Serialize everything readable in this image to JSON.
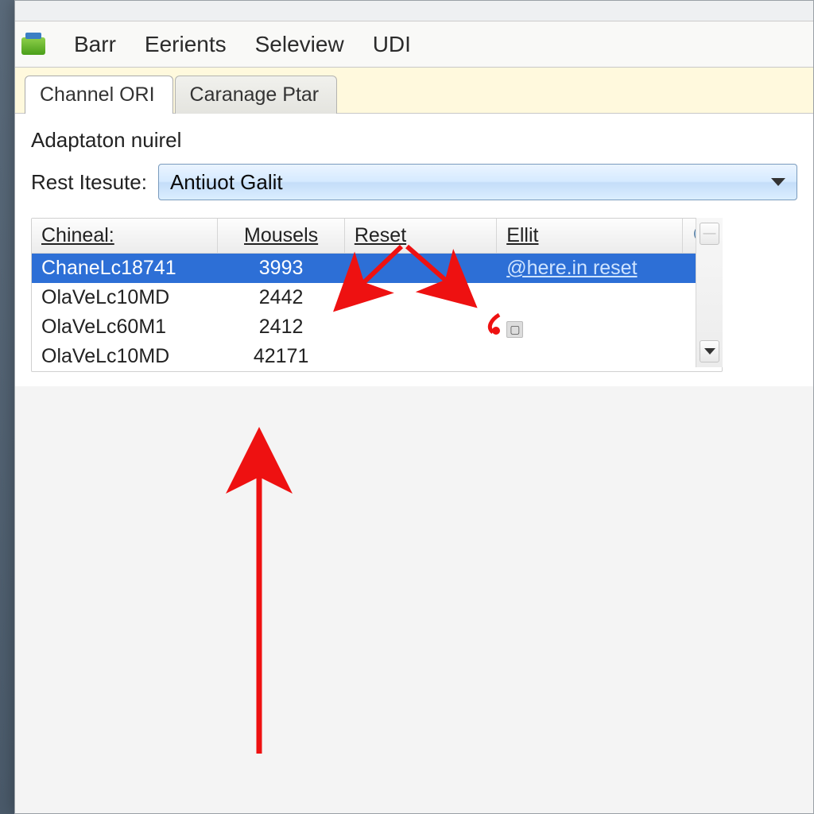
{
  "titlebar_text": "",
  "menu": {
    "items": [
      "Barr",
      "Eerients",
      "Seleview",
      "UDI"
    ]
  },
  "tabs": [
    {
      "label": "Channel ORI",
      "active": true
    },
    {
      "label": "Caranage Ptar",
      "active": false
    }
  ],
  "panel": {
    "section_title": "Adaptaton nuirel",
    "dropdown_label": "Rest Itesute:",
    "dropdown_value": "Antiuot Galit"
  },
  "table": {
    "headers": [
      "Chineal:",
      "Mousels",
      "Reset",
      "Ellit"
    ],
    "rows": [
      {
        "c0": "ChaneLc18741",
        "c1": "3993",
        "c2": "",
        "c3": "@here.in reset",
        "selected": true
      },
      {
        "c0": "OlaVeLc10MD",
        "c1": "2442",
        "c2": "",
        "c3": "",
        "selected": false
      },
      {
        "c0": "OlaVeLc60M1",
        "c1": "2412",
        "c2": "",
        "c3": "",
        "selected": false,
        "badge": true
      },
      {
        "c0": "OlaVeLc10MD",
        "c1": "42171",
        "c2": "",
        "c3": "",
        "selected": false
      }
    ]
  }
}
